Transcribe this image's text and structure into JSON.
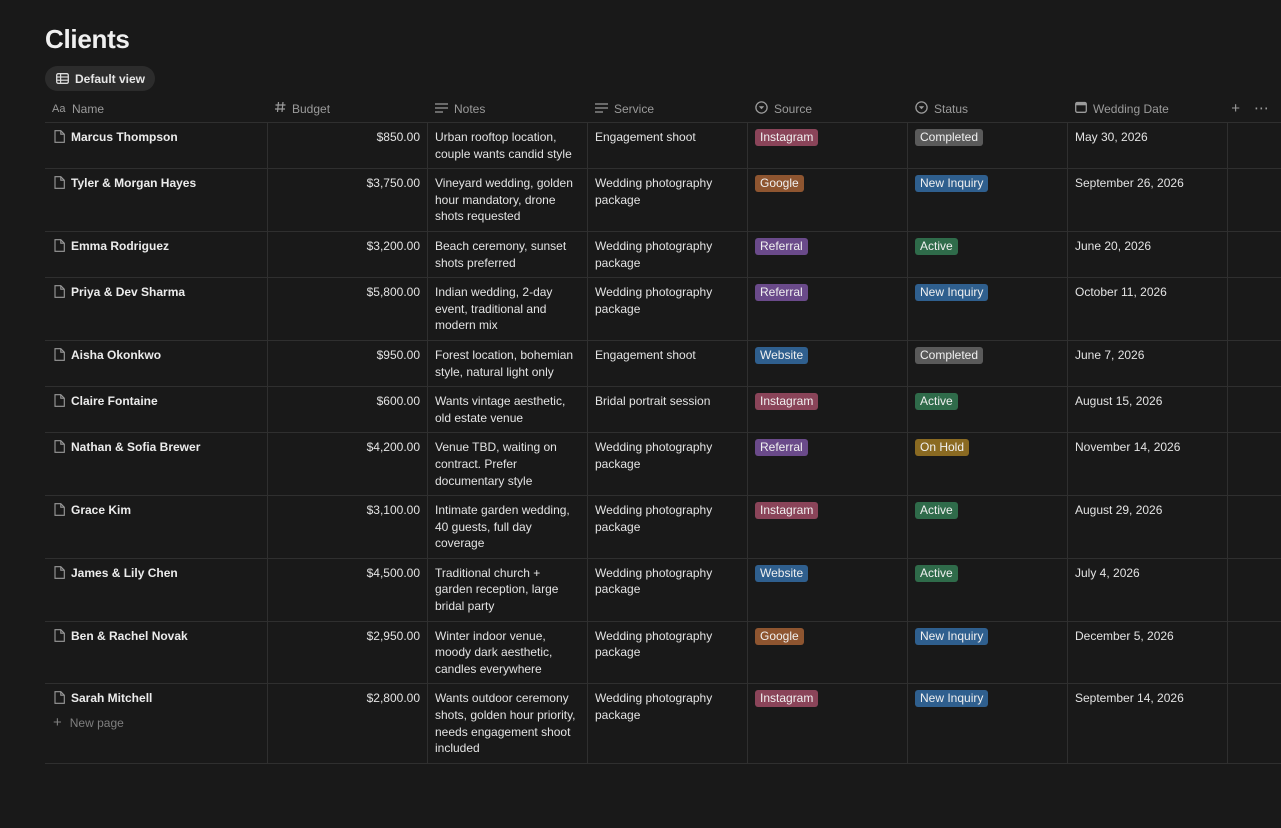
{
  "page": {
    "title": "Clients"
  },
  "view": {
    "label": "Default view"
  },
  "columns": {
    "name": "Name",
    "budget": "Budget",
    "notes": "Notes",
    "service": "Service",
    "source": "Source",
    "status": "Status",
    "date": "Wedding Date"
  },
  "tag_colors": {
    "Instagram": "#8a4459",
    "Google": "#8e5530",
    "Referral": "#6a4a8a",
    "Website": "#2f5f8e",
    "Completed": "#5a5a5a",
    "New Inquiry": "#2f5f8e",
    "Active": "#2f6b4a",
    "On Hold": "#8a6a22"
  },
  "rows": [
    {
      "name": "Marcus Thompson",
      "budget": "$850.00",
      "notes": "Urban rooftop location, couple wants candid style",
      "service": "Engagement shoot",
      "source": "Instagram",
      "status": "Completed",
      "date": "May 30, 2026"
    },
    {
      "name": "Tyler & Morgan Hayes",
      "budget": "$3,750.00",
      "notes": "Vineyard wedding, golden hour mandatory, drone shots requested",
      "service": "Wedding photography package",
      "source": "Google",
      "status": "New Inquiry",
      "date": "September 26, 2026"
    },
    {
      "name": "Emma Rodriguez",
      "budget": "$3,200.00",
      "notes": "Beach ceremony, sunset shots preferred",
      "service": "Wedding photography package",
      "source": "Referral",
      "status": "Active",
      "date": "June 20, 2026"
    },
    {
      "name": "Priya & Dev Sharma",
      "budget": "$5,800.00",
      "notes": "Indian wedding, 2-day event, traditional and modern mix",
      "service": "Wedding photography package",
      "source": "Referral",
      "status": "New Inquiry",
      "date": "October 11, 2026"
    },
    {
      "name": "Aisha Okonkwo",
      "budget": "$950.00",
      "notes": "Forest location, bohemian style, natural light only",
      "service": "Engagement shoot",
      "source": "Website",
      "status": "Completed",
      "date": "June 7, 2026"
    },
    {
      "name": "Claire Fontaine",
      "budget": "$600.00",
      "notes": "Wants vintage aesthetic, old estate venue",
      "service": "Bridal portrait session",
      "source": "Instagram",
      "status": "Active",
      "date": "August 15, 2026"
    },
    {
      "name": "Nathan & Sofia Brewer",
      "budget": "$4,200.00",
      "notes": "Venue TBD, waiting on contract. Prefer documentary style",
      "service": "Wedding photography package",
      "source": "Referral",
      "status": "On Hold",
      "date": "November 14, 2026"
    },
    {
      "name": "Grace Kim",
      "budget": "$3,100.00",
      "notes": "Intimate garden wedding, 40 guests, full day coverage",
      "service": "Wedding photography package",
      "source": "Instagram",
      "status": "Active",
      "date": "August 29, 2026"
    },
    {
      "name": "James & Lily Chen",
      "budget": "$4,500.00",
      "notes": "Traditional church + garden reception, large bridal party",
      "service": "Wedding photography package",
      "source": "Website",
      "status": "Active",
      "date": "July 4, 2026"
    },
    {
      "name": "Ben & Rachel Novak",
      "budget": "$2,950.00",
      "notes": "Winter indoor venue, moody dark aesthetic, candles everywhere",
      "service": "Wedding photography package",
      "source": "Google",
      "status": "New Inquiry",
      "date": "December 5, 2026"
    },
    {
      "name": "Sarah Mitchell",
      "budget": "$2,800.00",
      "notes": "Wants outdoor ceremony shots, golden hour priority, needs engagement shoot included",
      "service": "Wedding photography package",
      "source": "Instagram",
      "status": "New Inquiry",
      "date": "September 14, 2026"
    }
  ],
  "footer": {
    "new_page": "New page"
  }
}
